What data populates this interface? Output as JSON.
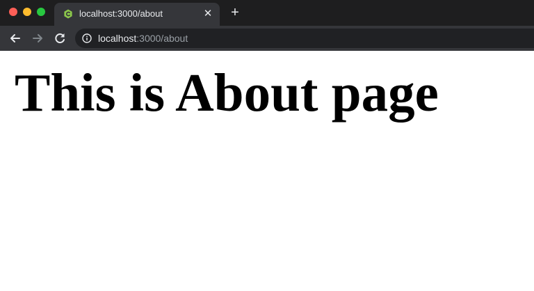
{
  "colors": {
    "tab_bar": "#1e1e1f",
    "toolbar": "#35363a",
    "omnibox": "#202124",
    "favicon": "#8cc84b",
    "traffic_red": "#fe5f57",
    "traffic_yellow": "#febc2e",
    "traffic_green": "#28c840"
  },
  "tab": {
    "title": "localhost:3000/about",
    "favicon_icon": "nodejs-icon",
    "close_glyph": "✕"
  },
  "new_tab_glyph": "+",
  "address_bar": {
    "host": "localhost",
    "path": ":3000/about",
    "icon": "info-icon"
  },
  "page": {
    "heading": "This is About page"
  }
}
